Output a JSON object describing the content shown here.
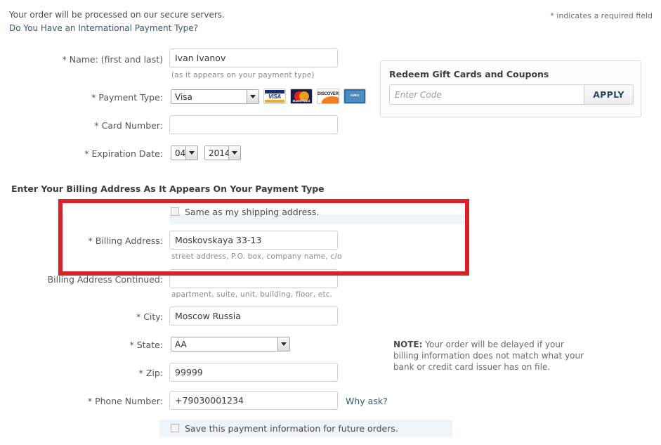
{
  "header": {
    "secure_notice": "Your order will be processed on our secure servers.",
    "international_link": "Do You Have an International Payment Type?",
    "required_note": "* indicates a required field"
  },
  "payment_section": {
    "name": {
      "label": "* Name: (first and last)",
      "value": "Ivan Ivanov",
      "hint": "(as it appears on your payment type)"
    },
    "payment_type": {
      "label": "* Payment Type:",
      "value": "Visa"
    },
    "card_number": {
      "label": "* Card Number:",
      "value": ""
    },
    "expiration": {
      "label": "* Expiration Date:",
      "month": "04",
      "year": "2014"
    },
    "accepted_cards": [
      {
        "name": "visa-card-icon",
        "text": "VISA"
      },
      {
        "name": "mastercard-card-icon",
        "text": "MasterCard"
      },
      {
        "name": "discover-card-icon",
        "text": "DISCOVER"
      },
      {
        "name": "amex-card-icon",
        "text": "AMEX"
      }
    ]
  },
  "gift_card": {
    "title": "Redeem Gift Cards and Coupons",
    "input_placeholder": "Enter Code",
    "input_value": "",
    "apply_label": "APPLY"
  },
  "billing_section": {
    "heading": "Enter Your Billing Address As It Appears On Your Payment Type",
    "same_as_shipping": {
      "label": "Same as my shipping address.",
      "checked": false
    },
    "billing_address": {
      "label": "* Billing Address:",
      "value": "Moskovskaya 33-13",
      "hint": "street address, P.O. box, company name, c/o"
    },
    "billing_address_continued": {
      "label": "Billing Address Continued:",
      "value": "",
      "hint": "apartment, suite, unit, building, floor, etc."
    },
    "city": {
      "label": "* City:",
      "value": "Moscow Russia"
    },
    "state": {
      "label": "* State:",
      "value": "AA"
    },
    "zip": {
      "label": "* Zip:",
      "value": "99999"
    },
    "phone": {
      "label": "* Phone Number:",
      "value": "+79030001234",
      "why_ask_label": "Why ask?"
    }
  },
  "note": {
    "prefix": "NOTE:",
    "text": " Your order will be delayed if your billing information does not match what your bank or credit card issuer has on file."
  },
  "save_payment": {
    "label": "Save this payment information for future orders.",
    "checked": false
  },
  "colors": {
    "link": "#3c5a72",
    "annotation_red": "#d6222a",
    "highlight_band": "#eef4fa"
  }
}
